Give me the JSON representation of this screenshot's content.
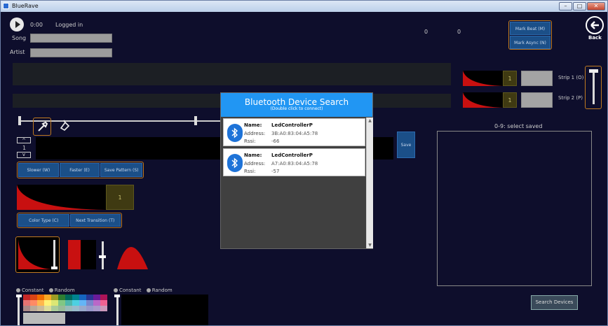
{
  "window": {
    "title": "BlueRave",
    "min": "–",
    "max": "□",
    "close": "✕"
  },
  "player": {
    "time": "0:00",
    "status": "Logged in"
  },
  "song": {
    "label": "Song",
    "value": ""
  },
  "artist": {
    "label": "Artist",
    "value": ""
  },
  "counters": {
    "a": "0",
    "b": "0"
  },
  "beat": {
    "mark_beat": "Mark Beat (M)",
    "mark_async": "Mark Async (N)"
  },
  "back": {
    "label": "Back"
  },
  "strips": [
    {
      "label": "Strip 1 (O)",
      "num": "1"
    },
    {
      "label": "Strip 2 (P)",
      "num": "1"
    }
  ],
  "stepper": {
    "up": "^",
    "value": "1",
    "down": "v"
  },
  "save": {
    "label": "Save"
  },
  "speed": {
    "slower": "Slower (W)",
    "faster": "Faster (E)",
    "save_pattern": "Save Pattern (S)"
  },
  "pattern_num": "1",
  "color": {
    "type": "Color Type (C)",
    "next": "Next Transition (T)"
  },
  "radio1": {
    "constant": "Constant",
    "random": "Random"
  },
  "radio2": {
    "constant": "Constant",
    "random": "Random"
  },
  "saved": {
    "label": "0-9: select saved"
  },
  "search_button": "Search Devices",
  "modal": {
    "title": "Bluetooth Device Search",
    "subtitle": "(Double click to connect)",
    "name_key": "Name:",
    "address_key": "Address:",
    "rssi_key": "Rssi:",
    "devices": [
      {
        "name": "LedControllerP",
        "address": "3B:A0:83:04:A5:78",
        "rssi": "-66"
      },
      {
        "name": "LedControllerP",
        "address": "A7:A0:83:04:A5:78",
        "rssi": "-57"
      }
    ]
  },
  "colors": {
    "accent_orange": "#c07a20",
    "modal_blue": "#2196f3",
    "button_blue": "#1b4f88",
    "curve_red": "#c81010"
  }
}
